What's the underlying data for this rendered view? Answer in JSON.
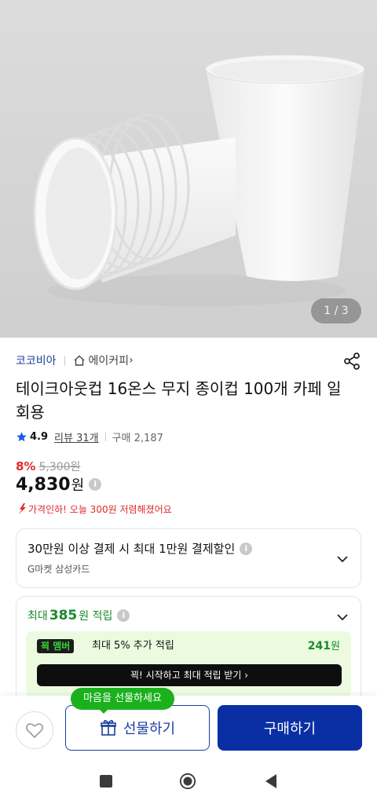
{
  "image": {
    "counter": "1 / 3"
  },
  "seller": {
    "name": "코코비아",
    "store": "에이커피",
    "store_chevron": "›"
  },
  "product": {
    "title": "테이크아웃컵 16온스 무지 종이컵 100개 카페 일회용"
  },
  "rating": {
    "score": "4.9",
    "reviews": "리뷰 31개",
    "purchases": "구매 2,187"
  },
  "price": {
    "discount_rate": "8%",
    "original": "5,300원",
    "current": "4,830",
    "currency": "원",
    "drop_notice": "가격인하! 오늘 300원 저렴해졌어요"
  },
  "card_payment": {
    "title": "30만원 이상 결제 시 최대 1만원 결제할인",
    "subtitle": "G마켓 삼성카드"
  },
  "points": {
    "prefix": "최대",
    "amount": "385",
    "suffix": "원 적립",
    "member_badge": "꾁 멤버",
    "member_text": "최대 5% 추가 적립",
    "member_amount": "241",
    "member_unit": "원",
    "member_cta": "꾁! 시작하고 최대 적립 받기 ›"
  },
  "bottom": {
    "tooltip": "마음을 선물하세요",
    "gift_label": "선물하기",
    "buy_label": "구매하기"
  },
  "colors": {
    "brand_blue": "#0a2fa5",
    "green": "#1bb11d",
    "sale_red": "#e02a2a"
  },
  "icons": [
    "share-icon",
    "home-icon",
    "star-icon",
    "info-icon",
    "chevron-down-icon",
    "heart-icon",
    "gift-icon",
    "square-icon",
    "circle-icon",
    "back-icon"
  ]
}
